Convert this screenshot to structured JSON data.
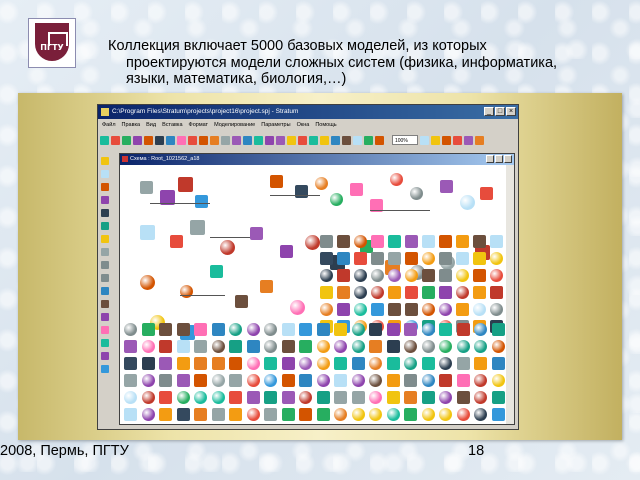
{
  "slide": {
    "description_lines": [
      "Коллекция включает 5000 базовых моделей, из которых",
      "проектируются модели сложных систем (физика, информатика,",
      "языки, математика, биология,…)"
    ],
    "footer_left": "2008, Пермь, ПГТУ",
    "page_number": "18",
    "logo_text": "ПГТУ"
  },
  "app_window": {
    "title": "C:\\Program Files\\Stratum\\projects\\project16\\project.spj - Stratum",
    "menu": [
      "Файл",
      "Правка",
      "Вид",
      "Вставка",
      "Формат",
      "Моделирование",
      "Параметры",
      "Окна",
      "Помощь"
    ],
    "zoom_value": "100%",
    "child_window_title": "Схема : Root_1021562_a18"
  },
  "colors": {
    "titlebar": "#0a246a",
    "frame_gold": "#ede3a8",
    "window_face": "#d4d0c8"
  }
}
